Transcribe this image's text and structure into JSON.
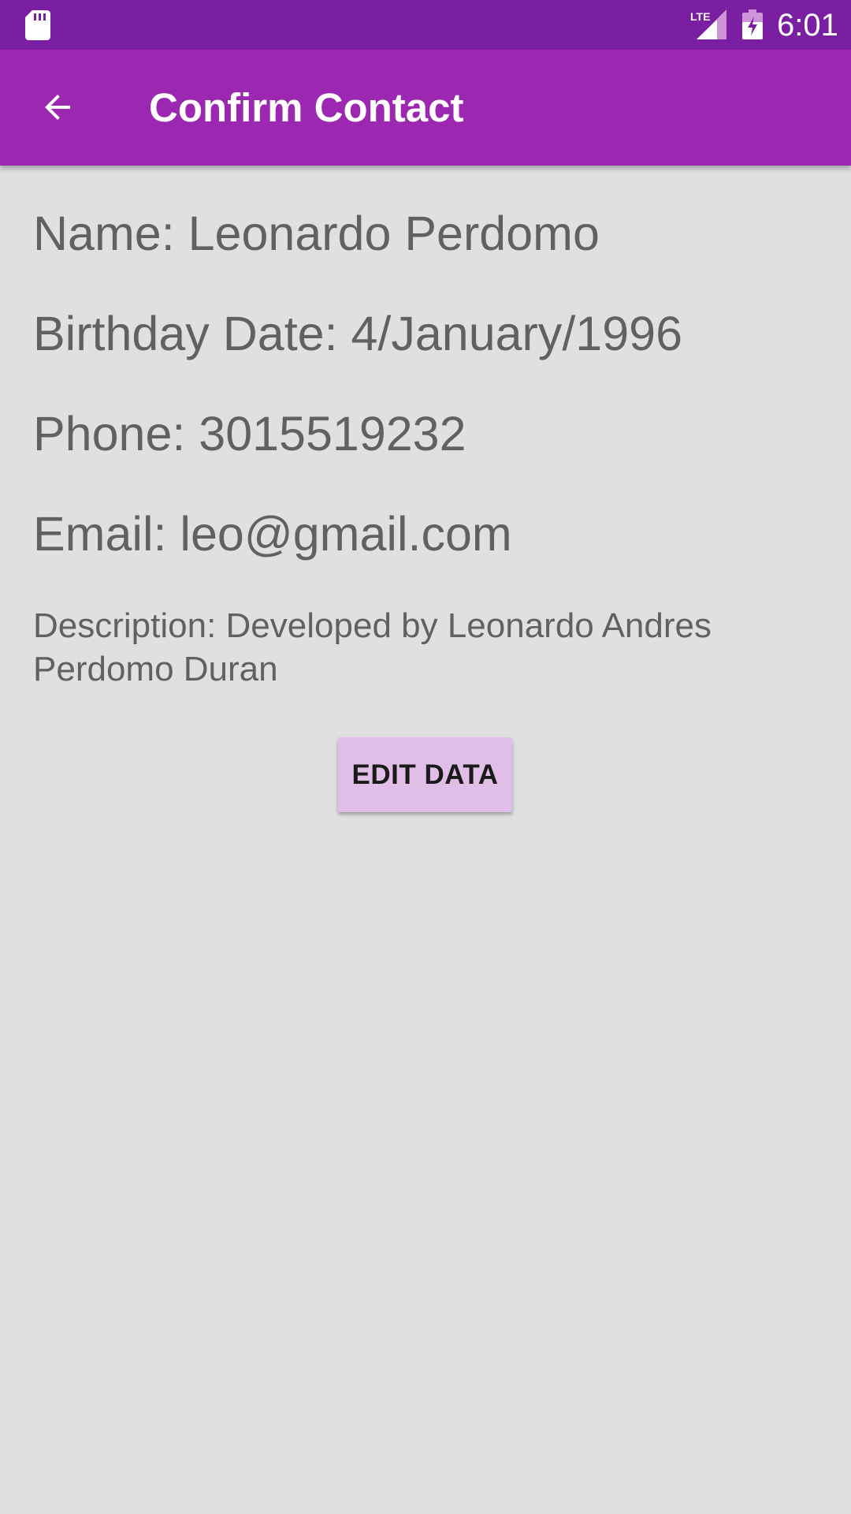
{
  "status_bar": {
    "time": "6:01",
    "network_label": "LTE",
    "icons": [
      "sd-card-icon",
      "lte-signal-icon",
      "battery-charging-icon"
    ],
    "color": "#7b1fa2"
  },
  "app_bar": {
    "title": "Confirm Contact",
    "back_icon": "arrow-back-icon",
    "color": "#9c27b0"
  },
  "contact": {
    "name": "Name: Leonardo Perdomo",
    "birthday": "Birthday Date: 4/January/1996",
    "phone": "Phone: 3015519232",
    "email": "Email: leo@gmail.com",
    "description": "Description: Developed by Leonardo Andres Perdomo Duran"
  },
  "actions": {
    "edit_label": "EDIT DATA",
    "edit_color": "#e1bee7"
  }
}
